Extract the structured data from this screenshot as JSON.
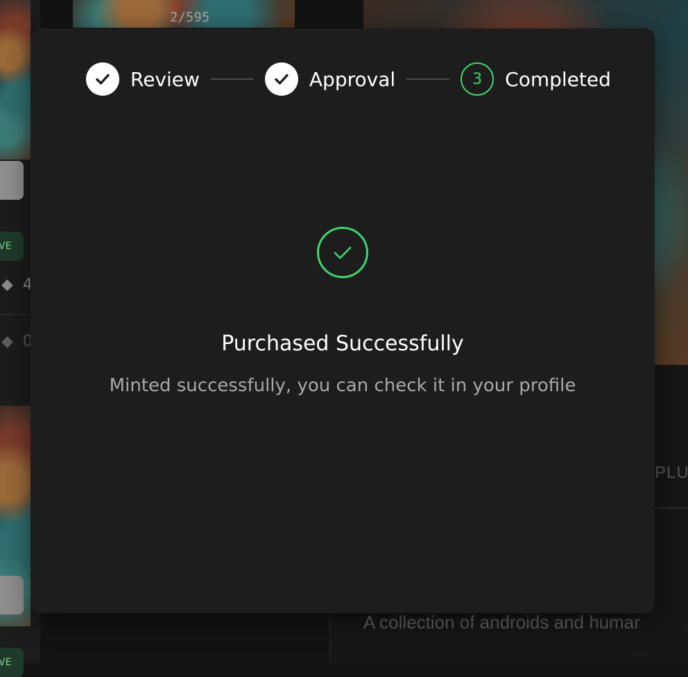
{
  "background": {
    "mint_counter": "2/595",
    "badge_text": "VE",
    "price_values": [
      "4",
      "0"
    ],
    "tab_partial": "PLU",
    "collection_description": "A collection of androids and humar"
  },
  "modal": {
    "steps": [
      {
        "label": "Review",
        "state": "done",
        "icon": "check-icon"
      },
      {
        "label": "Approval",
        "state": "done",
        "icon": "check-icon"
      },
      {
        "label": "Completed",
        "state": "active",
        "number": "3"
      }
    ],
    "success_icon": "check-circle-icon",
    "title": "Purchased Successfully",
    "message": "Minted successfully, you can check it in your profile"
  },
  "colors": {
    "accent_green": "#3ed66d",
    "modal_bg": "#1d1d1d",
    "step_done_bg": "#ffffff"
  }
}
